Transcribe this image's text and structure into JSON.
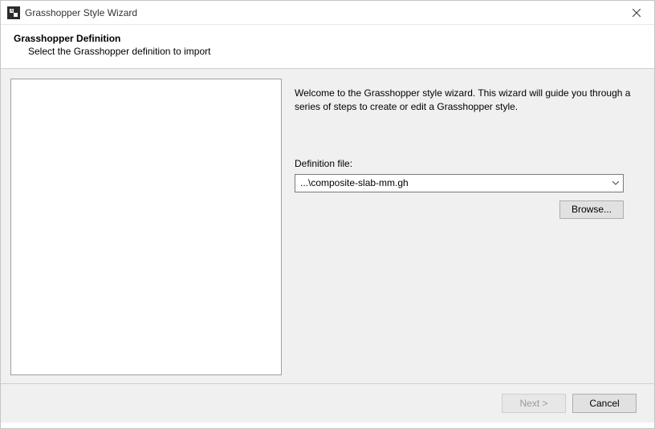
{
  "window": {
    "title": "Grasshopper Style Wizard"
  },
  "header": {
    "title": "Grasshopper Definition",
    "subtitle": "Select the Grasshopper definition to import"
  },
  "content": {
    "welcome": "Welcome to the Grasshopper style wizard. This wizard will guide you through a series of steps to create or edit a Grasshopper style.",
    "definition_label": "Definition file:",
    "definition_value": "...\\composite-slab-mm.gh",
    "browse_label": "Browse..."
  },
  "footer": {
    "next_label": "Next >",
    "cancel_label": "Cancel"
  }
}
